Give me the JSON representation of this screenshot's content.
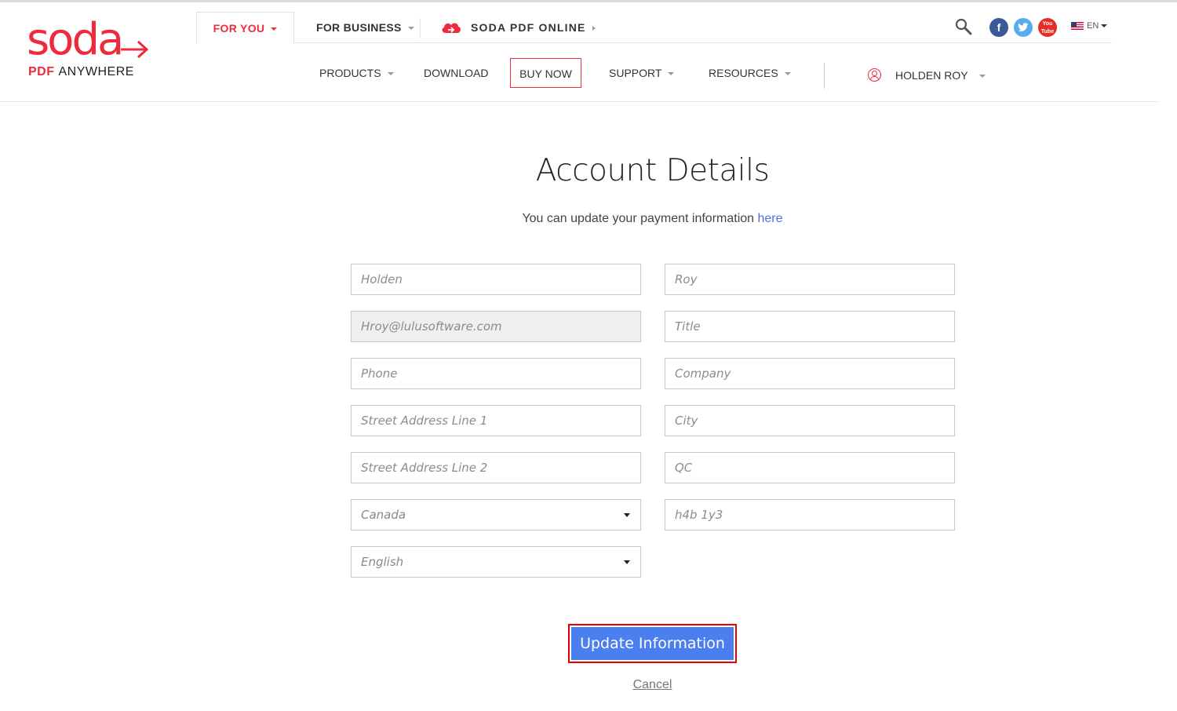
{
  "brand": {
    "logo_word": "soda",
    "logo_pdf": "PDF",
    "logo_anywhere": "ANYWHERE",
    "accent_color": "#ee2b3d"
  },
  "top_tabs": {
    "for_you": "FOR YOU",
    "for_business": "FOR BUSINESS",
    "soda_online": "SODA PDF ONLINE"
  },
  "utilities": {
    "search_icon": "search-icon",
    "social": [
      "facebook-icon",
      "twitter-icon",
      "youtube-icon"
    ],
    "youtube_label": "You Tube",
    "language": "EN"
  },
  "nav": {
    "products": "PRODUCTS",
    "download": "DOWNLOAD",
    "buy_now": "BUY NOW",
    "support": "SUPPORT",
    "resources": "RESOURCES",
    "user_name": "HOLDEN ROY"
  },
  "main": {
    "title": "Account Details",
    "subtitle_text": "You can update your payment information ",
    "subtitle_link": "here",
    "link_color": "#4a6fe3"
  },
  "form": {
    "first_name": {
      "placeholder": "Holden"
    },
    "last_name": {
      "placeholder": "Roy"
    },
    "email": {
      "placeholder": "Hroy@lulusoftware.com"
    },
    "title": {
      "placeholder": "Title"
    },
    "phone": {
      "placeholder": "Phone"
    },
    "company": {
      "placeholder": "Company"
    },
    "street1": {
      "placeholder": "Street Address Line 1"
    },
    "city": {
      "placeholder": "City"
    },
    "street2": {
      "placeholder": "Street Address Line 2"
    },
    "province": {
      "placeholder": "QC"
    },
    "country": {
      "selected": "Canada"
    },
    "postal": {
      "placeholder": "h4b 1y3"
    },
    "language": {
      "selected": "English"
    }
  },
  "actions": {
    "update": "Update Information",
    "update_color": "#4b7eef",
    "cancel": "Cancel"
  }
}
